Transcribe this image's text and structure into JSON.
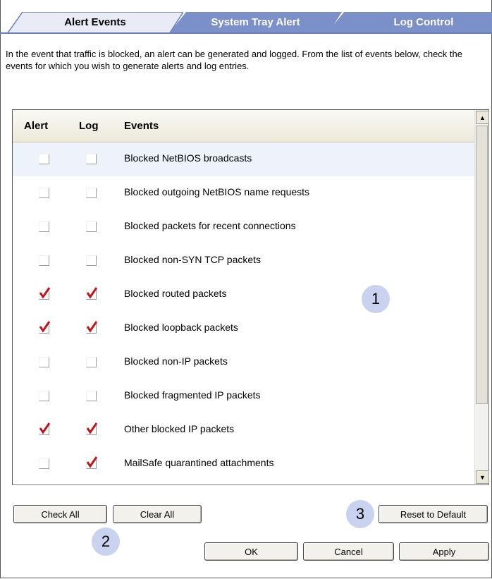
{
  "tabs": [
    {
      "label": "Alert Events",
      "active": true
    },
    {
      "label": "System Tray Alert",
      "active": false
    },
    {
      "label": "Log Control",
      "active": false
    }
  ],
  "description": "In the event that traffic is blocked, an alert can be generated and logged. From the list of events below, check the events for which you wish to generate alerts and log entries.",
  "list": {
    "headers": {
      "alert": "Alert",
      "log": "Log",
      "events": "Events"
    },
    "rows": [
      {
        "event": "Blocked NetBIOS broadcasts",
        "alert": false,
        "log": false
      },
      {
        "event": "Blocked outgoing NetBIOS name requests",
        "alert": false,
        "log": false
      },
      {
        "event": "Blocked packets for recent connections",
        "alert": false,
        "log": false
      },
      {
        "event": "Blocked non-SYN TCP packets",
        "alert": false,
        "log": false
      },
      {
        "event": "Blocked routed packets",
        "alert": true,
        "log": true
      },
      {
        "event": "Blocked loopback packets",
        "alert": true,
        "log": true
      },
      {
        "event": "Blocked non-IP packets",
        "alert": false,
        "log": false
      },
      {
        "event": "Blocked fragmented IP packets",
        "alert": false,
        "log": false
      },
      {
        "event": "Other blocked IP packets",
        "alert": true,
        "log": true
      },
      {
        "event": "MailSafe quarantined attachments",
        "alert": false,
        "log": true
      }
    ]
  },
  "buttons": {
    "check_all": "Check All",
    "clear_all": "Clear All",
    "reset_default": "Reset to Default",
    "ok": "OK",
    "cancel": "Cancel",
    "apply": "Apply"
  },
  "callouts": {
    "one": "1",
    "two": "2",
    "three": "3"
  },
  "colors": {
    "tab_blue": "#7b8fc9",
    "tab_active": "#e9ecf7",
    "check_red": "#c0141c",
    "callout": "#c9d3ef"
  }
}
